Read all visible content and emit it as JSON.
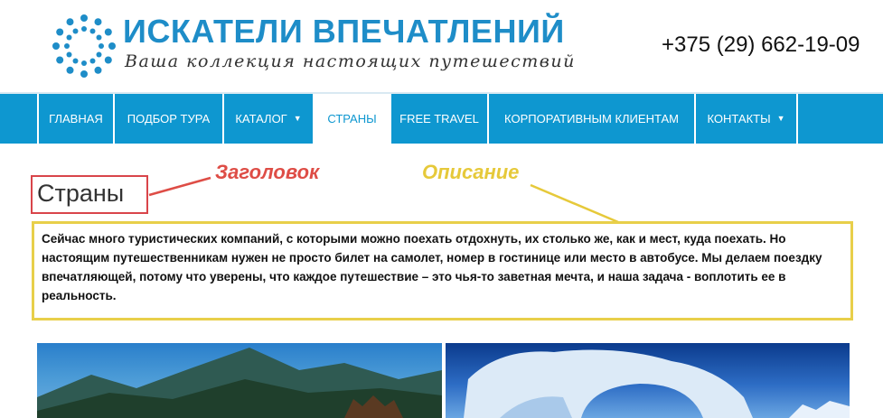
{
  "header": {
    "logo_title": "ИСКАТЕЛИ ВПЕЧАТЛЕНИЙ",
    "logo_tagline": "Ваша коллекция настоящих путешествий",
    "phone": "+375 (29) 662-19-09"
  },
  "nav": {
    "items": [
      {
        "label": "ГЛАВНАЯ",
        "has_dropdown": false,
        "active": false
      },
      {
        "label": "ПОДБОР ТУРА",
        "has_dropdown": false,
        "active": false
      },
      {
        "label": "КАТАЛОГ",
        "has_dropdown": true,
        "active": false
      },
      {
        "label": "СТРАНЫ",
        "has_dropdown": false,
        "active": true
      },
      {
        "label": "FREE TRAVEL",
        "has_dropdown": false,
        "active": false
      },
      {
        "label": "КОРПОРАТИВНЫМ КЛИЕНТАМ",
        "has_dropdown": false,
        "active": false
      },
      {
        "label": "КОНТАКТЫ",
        "has_dropdown": true,
        "active": false
      }
    ]
  },
  "content": {
    "title": "Страны",
    "description": "Сейчас много туристических компаний, с которыми можно поехать отдохнуть, их столько же, как и мест, куда поехать. Но настоящим путешественникам нужен не просто билет на самолет, номер в гостинице или место в автобусе. Мы делаем поездку впечатляющей, потому что уверены, что каждое путешествие – это чья-то заветная мечта, и наша задача - воплотить ее в реальность."
  },
  "annotations": {
    "heading_label": "Заголовок",
    "description_label": "Описание"
  },
  "colors": {
    "brand_blue": "#1e8dc8",
    "nav_blue": "#0e97d0",
    "annotation_red": "#de4d46",
    "annotation_yellow": "#e6c93a"
  }
}
